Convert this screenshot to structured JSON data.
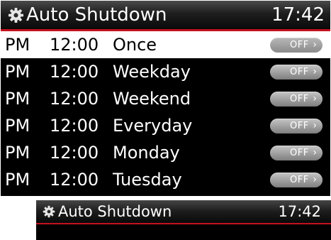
{
  "header": {
    "title": "Auto Shutdown",
    "clock": "17:42",
    "icon": "gear-icon"
  },
  "rows": [
    {
      "ampm": "PM",
      "time": "12:00",
      "label": "Once",
      "toggle": "OFF",
      "selected": true
    },
    {
      "ampm": "PM",
      "time": "12:00",
      "label": "Weekday",
      "toggle": "OFF",
      "selected": false
    },
    {
      "ampm": "PM",
      "time": "12:00",
      "label": "Weekend",
      "toggle": "OFF",
      "selected": false
    },
    {
      "ampm": "PM",
      "time": "12:00",
      "label": "Everyday",
      "toggle": "OFF",
      "selected": false
    },
    {
      "ampm": "PM",
      "time": "12:00",
      "label": "Monday",
      "toggle": "OFF",
      "selected": false
    },
    {
      "ampm": "PM",
      "time": "12:00",
      "label": "Tuesday",
      "toggle": "OFF",
      "selected": false
    }
  ],
  "thumbnail": {
    "title": "Auto Shutdown",
    "clock": "17:42",
    "icon": "gear-icon"
  },
  "colors": {
    "accent": "#c4121e",
    "selected_bg": "#ffffff",
    "background": "#000000"
  }
}
